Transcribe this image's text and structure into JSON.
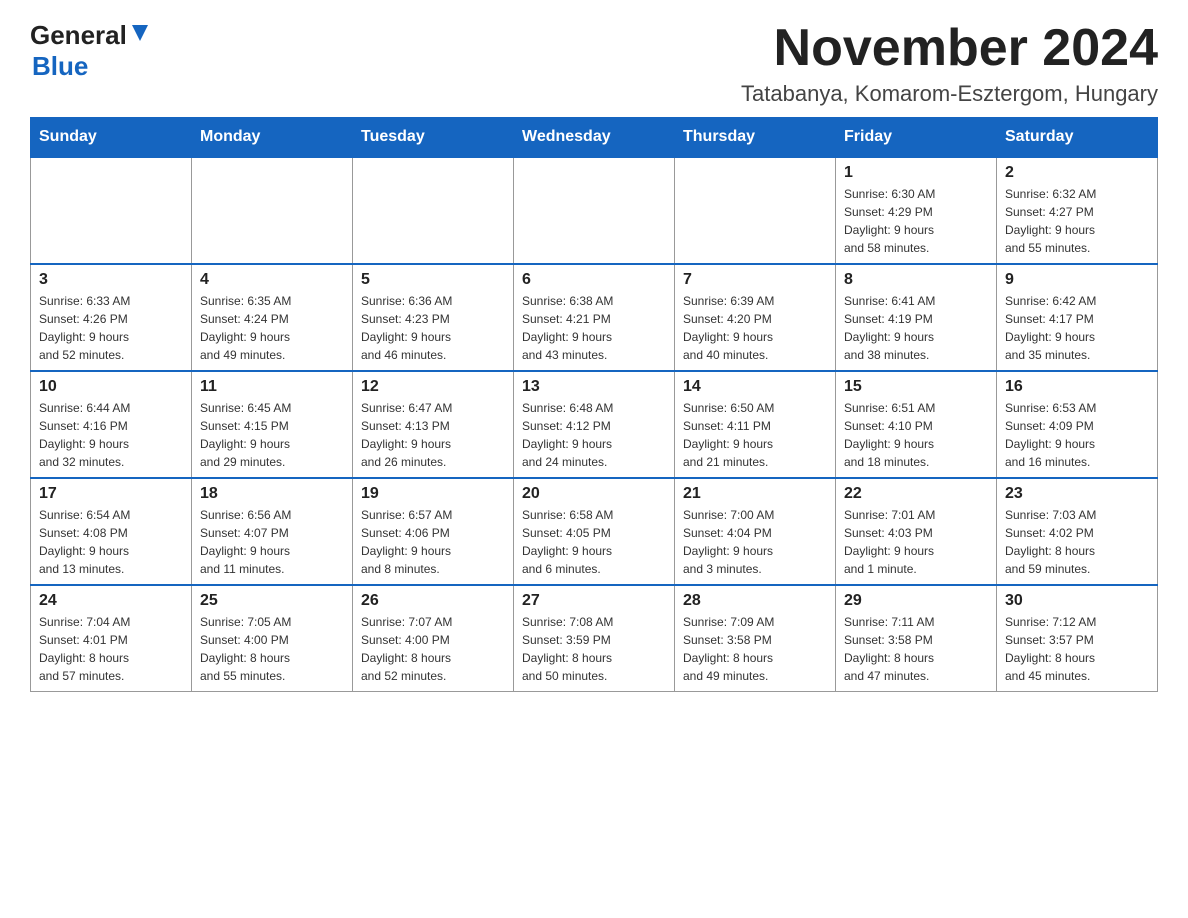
{
  "logo": {
    "general": "General",
    "blue": "Blue"
  },
  "title": "November 2024",
  "subtitle": "Tatabanya, Komarom-Esztergom, Hungary",
  "days_of_week": [
    "Sunday",
    "Monday",
    "Tuesday",
    "Wednesday",
    "Thursday",
    "Friday",
    "Saturday"
  ],
  "weeks": [
    [
      {
        "day": "",
        "info": ""
      },
      {
        "day": "",
        "info": ""
      },
      {
        "day": "",
        "info": ""
      },
      {
        "day": "",
        "info": ""
      },
      {
        "day": "",
        "info": ""
      },
      {
        "day": "1",
        "info": "Sunrise: 6:30 AM\nSunset: 4:29 PM\nDaylight: 9 hours\nand 58 minutes."
      },
      {
        "day": "2",
        "info": "Sunrise: 6:32 AM\nSunset: 4:27 PM\nDaylight: 9 hours\nand 55 minutes."
      }
    ],
    [
      {
        "day": "3",
        "info": "Sunrise: 6:33 AM\nSunset: 4:26 PM\nDaylight: 9 hours\nand 52 minutes."
      },
      {
        "day": "4",
        "info": "Sunrise: 6:35 AM\nSunset: 4:24 PM\nDaylight: 9 hours\nand 49 minutes."
      },
      {
        "day": "5",
        "info": "Sunrise: 6:36 AM\nSunset: 4:23 PM\nDaylight: 9 hours\nand 46 minutes."
      },
      {
        "day": "6",
        "info": "Sunrise: 6:38 AM\nSunset: 4:21 PM\nDaylight: 9 hours\nand 43 minutes."
      },
      {
        "day": "7",
        "info": "Sunrise: 6:39 AM\nSunset: 4:20 PM\nDaylight: 9 hours\nand 40 minutes."
      },
      {
        "day": "8",
        "info": "Sunrise: 6:41 AM\nSunset: 4:19 PM\nDaylight: 9 hours\nand 38 minutes."
      },
      {
        "day": "9",
        "info": "Sunrise: 6:42 AM\nSunset: 4:17 PM\nDaylight: 9 hours\nand 35 minutes."
      }
    ],
    [
      {
        "day": "10",
        "info": "Sunrise: 6:44 AM\nSunset: 4:16 PM\nDaylight: 9 hours\nand 32 minutes."
      },
      {
        "day": "11",
        "info": "Sunrise: 6:45 AM\nSunset: 4:15 PM\nDaylight: 9 hours\nand 29 minutes."
      },
      {
        "day": "12",
        "info": "Sunrise: 6:47 AM\nSunset: 4:13 PM\nDaylight: 9 hours\nand 26 minutes."
      },
      {
        "day": "13",
        "info": "Sunrise: 6:48 AM\nSunset: 4:12 PM\nDaylight: 9 hours\nand 24 minutes."
      },
      {
        "day": "14",
        "info": "Sunrise: 6:50 AM\nSunset: 4:11 PM\nDaylight: 9 hours\nand 21 minutes."
      },
      {
        "day": "15",
        "info": "Sunrise: 6:51 AM\nSunset: 4:10 PM\nDaylight: 9 hours\nand 18 minutes."
      },
      {
        "day": "16",
        "info": "Sunrise: 6:53 AM\nSunset: 4:09 PM\nDaylight: 9 hours\nand 16 minutes."
      }
    ],
    [
      {
        "day": "17",
        "info": "Sunrise: 6:54 AM\nSunset: 4:08 PM\nDaylight: 9 hours\nand 13 minutes."
      },
      {
        "day": "18",
        "info": "Sunrise: 6:56 AM\nSunset: 4:07 PM\nDaylight: 9 hours\nand 11 minutes."
      },
      {
        "day": "19",
        "info": "Sunrise: 6:57 AM\nSunset: 4:06 PM\nDaylight: 9 hours\nand 8 minutes."
      },
      {
        "day": "20",
        "info": "Sunrise: 6:58 AM\nSunset: 4:05 PM\nDaylight: 9 hours\nand 6 minutes."
      },
      {
        "day": "21",
        "info": "Sunrise: 7:00 AM\nSunset: 4:04 PM\nDaylight: 9 hours\nand 3 minutes."
      },
      {
        "day": "22",
        "info": "Sunrise: 7:01 AM\nSunset: 4:03 PM\nDaylight: 9 hours\nand 1 minute."
      },
      {
        "day": "23",
        "info": "Sunrise: 7:03 AM\nSunset: 4:02 PM\nDaylight: 8 hours\nand 59 minutes."
      }
    ],
    [
      {
        "day": "24",
        "info": "Sunrise: 7:04 AM\nSunset: 4:01 PM\nDaylight: 8 hours\nand 57 minutes."
      },
      {
        "day": "25",
        "info": "Sunrise: 7:05 AM\nSunset: 4:00 PM\nDaylight: 8 hours\nand 55 minutes."
      },
      {
        "day": "26",
        "info": "Sunrise: 7:07 AM\nSunset: 4:00 PM\nDaylight: 8 hours\nand 52 minutes."
      },
      {
        "day": "27",
        "info": "Sunrise: 7:08 AM\nSunset: 3:59 PM\nDaylight: 8 hours\nand 50 minutes."
      },
      {
        "day": "28",
        "info": "Sunrise: 7:09 AM\nSunset: 3:58 PM\nDaylight: 8 hours\nand 49 minutes."
      },
      {
        "day": "29",
        "info": "Sunrise: 7:11 AM\nSunset: 3:58 PM\nDaylight: 8 hours\nand 47 minutes."
      },
      {
        "day": "30",
        "info": "Sunrise: 7:12 AM\nSunset: 3:57 PM\nDaylight: 8 hours\nand 45 minutes."
      }
    ]
  ]
}
